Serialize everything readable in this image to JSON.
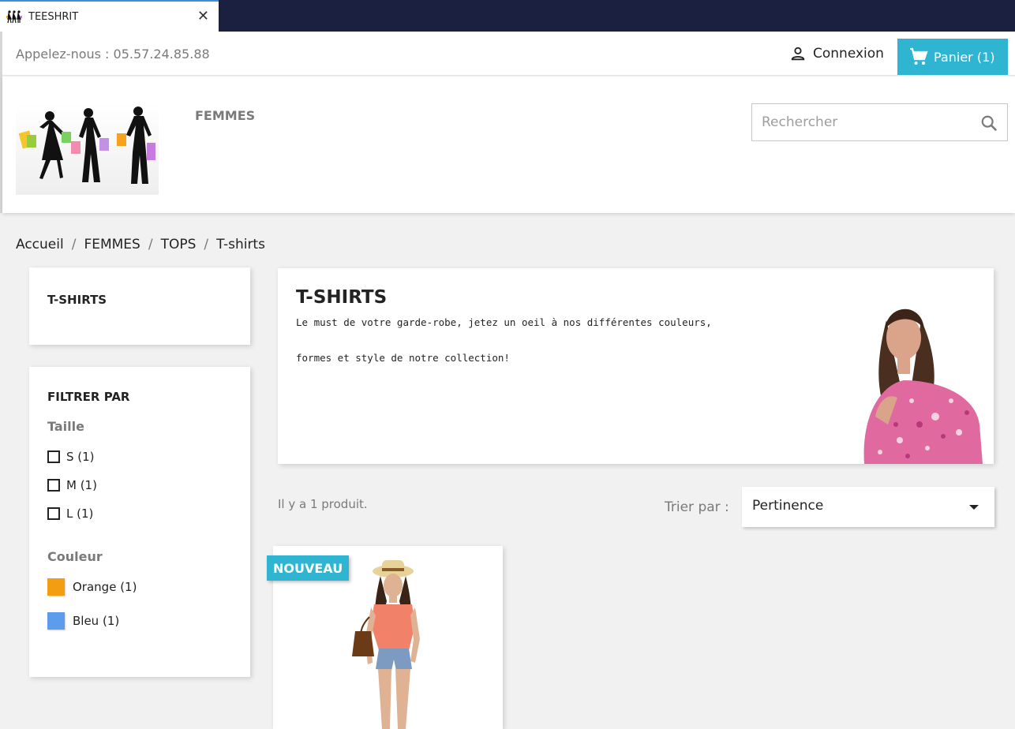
{
  "browser": {
    "tab_title": "TEESHRIT",
    "close_glyph": "✕"
  },
  "header": {
    "contact": "Appelez-nous : 05.57.24.85.88",
    "login_label": "Connexion",
    "cart_label": "Panier (1)",
    "menu_item": "FEMMES",
    "search_placeholder": "Rechercher"
  },
  "breadcrumb": [
    "Accueil",
    "FEMMES",
    "TOPS",
    "T-shirts"
  ],
  "sidebar": {
    "category_title": "T-SHIRTS",
    "filter_title": "FILTRER PAR",
    "size_facet": {
      "title": "Taille",
      "options": [
        "S (1)",
        "M (1)",
        "L (1)"
      ]
    },
    "color_facet": {
      "title": "Couleur",
      "options": [
        {
          "label": "Orange (1)",
          "color": "#f39d12"
        },
        {
          "label": "Bleu (1)",
          "color": "#5d9cec"
        }
      ]
    }
  },
  "category": {
    "title": "T-SHIRTS",
    "description_line1": "Le must de votre garde-robe, jetez un oeil à nos différentes couleurs,",
    "description_line2": "formes et style de notre collection!"
  },
  "listing": {
    "count": "Il y a 1 produit.",
    "sort_label": "Trier par :",
    "sort_value": "Pertinence"
  },
  "product": {
    "badge": "NOUVEAU"
  },
  "colors": {
    "accent": "#2fb5d2",
    "browser_bar": "#1b2040"
  }
}
